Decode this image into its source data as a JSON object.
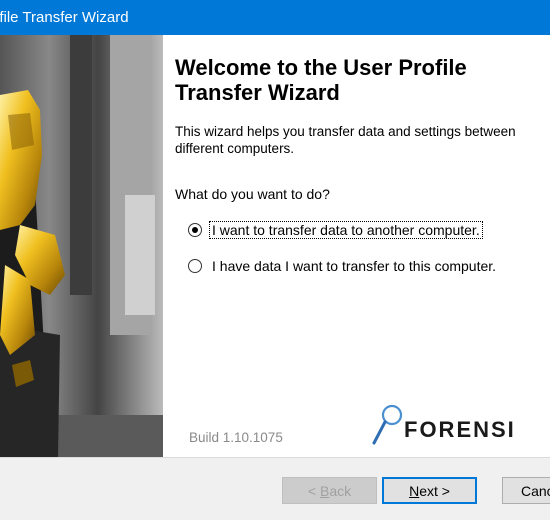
{
  "window": {
    "title": "ofile Transfer Wizard"
  },
  "wizard": {
    "heading": "Welcome to the User Profile Transfer Wizard",
    "intro": "This wizard helps you transfer data and settings between different computers.",
    "question": "What do you want to do?",
    "options": [
      {
        "label": "I want to transfer data to another computer.",
        "checked": true
      },
      {
        "label": "I have data I want to transfer to this computer.",
        "checked": false
      }
    ],
    "build": "Build 1.10.1075",
    "logo_text": "FORENSI"
  },
  "buttons": {
    "back": {
      "prefix": "< ",
      "accel": "B",
      "rest": "ack"
    },
    "next": {
      "accel": "N",
      "rest": "ext >"
    },
    "cancel": "Canc"
  },
  "colors": {
    "titlebar": "#0078d7",
    "focus_border": "#0078d7",
    "logo_gold": "#d4a017"
  }
}
